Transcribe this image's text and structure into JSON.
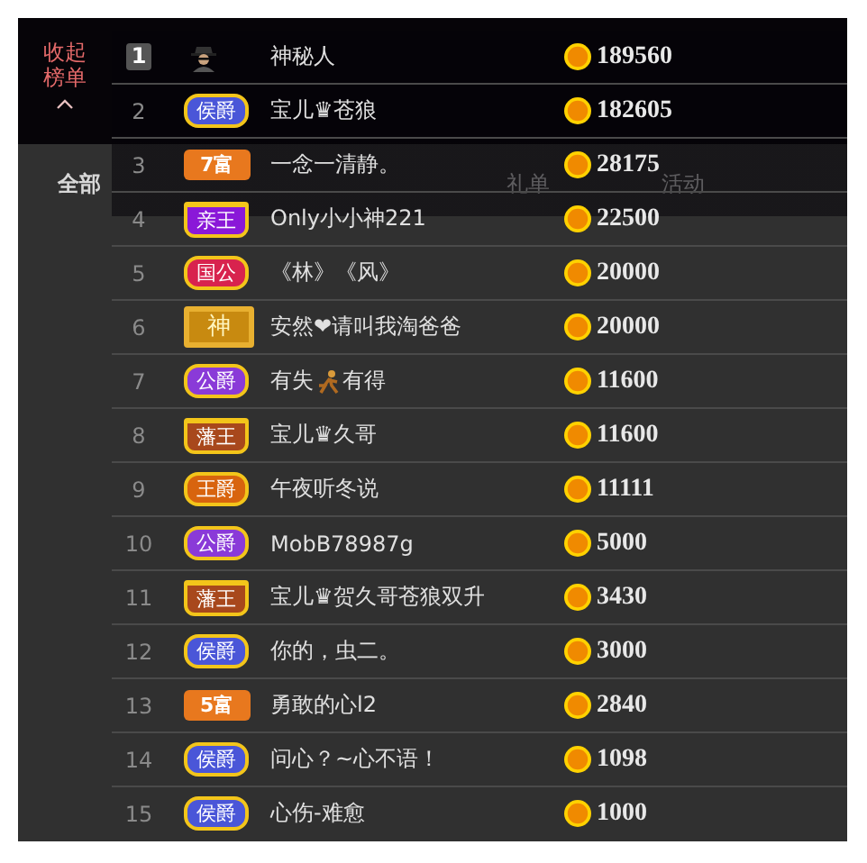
{
  "collapse": {
    "label": "收起榜单"
  },
  "tabs": [
    {
      "label": "全部",
      "selected": true
    },
    {
      "label": "礼单",
      "selected": false
    },
    {
      "label": "活动",
      "selected": false
    }
  ],
  "ranking": [
    {
      "rank": "1",
      "kind": "top",
      "name": [
        "神秘人"
      ],
      "coins": "189560"
    },
    {
      "rank": "2",
      "kind": "normal",
      "badge": {
        "kind": "noble",
        "text": "侯爵",
        "color": "#4a56d8"
      },
      "name": [
        "宝儿♛苍狼"
      ],
      "coins": "182605"
    },
    {
      "rank": "3",
      "kind": "normal",
      "badge": {
        "kind": "wealth",
        "text": "7富",
        "color": "#e8781e"
      },
      "name": [
        "一念一清静。"
      ],
      "coins": "28175"
    },
    {
      "rank": "4",
      "kind": "normal",
      "badge": {
        "kind": "crown",
        "text": "亲王",
        "color": "#8a18d8"
      },
      "name": [
        "Only小小神221"
      ],
      "coins": "22500"
    },
    {
      "rank": "5",
      "kind": "normal",
      "badge": {
        "kind": "noble",
        "text": "国公",
        "color": "#d8234e"
      },
      "name": [
        "《林》《风》"
      ],
      "coins": "20000"
    },
    {
      "rank": "6",
      "kind": "normal",
      "badge": {
        "kind": "god",
        "text": "神",
        "color": "#c88a10"
      },
      "name": [
        "安然❤请叫我淘爸爸"
      ],
      "coins": "20000"
    },
    {
      "rank": "7",
      "kind": "normal",
      "badge": {
        "kind": "noble",
        "text": "公爵",
        "color": "#8a3ad8"
      },
      "name": [
        "有失",
        "有得"
      ],
      "coins": "11600"
    },
    {
      "rank": "8",
      "kind": "normal",
      "badge": {
        "kind": "crown",
        "text": "藩王",
        "color": "#a8481c"
      },
      "name": [
        "宝儿♛久哥"
      ],
      "coins": "11600"
    },
    {
      "rank": "9",
      "kind": "normal",
      "badge": {
        "kind": "noble",
        "text": "王爵",
        "color": "#d8640e"
      },
      "name": [
        "午夜听冬说"
      ],
      "coins": "11111"
    },
    {
      "rank": "10",
      "kind": "normal",
      "badge": {
        "kind": "noble",
        "text": "公爵",
        "color": "#8a3ad8"
      },
      "name": [
        "MobB78987g"
      ],
      "coins": "5000"
    },
    {
      "rank": "11",
      "kind": "normal",
      "badge": {
        "kind": "crown",
        "text": "藩王",
        "color": "#a8481c"
      },
      "name": [
        "宝儿♛贺久哥苍狼双升"
      ],
      "coins": "3430"
    },
    {
      "rank": "12",
      "kind": "normal",
      "badge": {
        "kind": "noble",
        "text": "侯爵",
        "color": "#4a56d8"
      },
      "name": [
        "你的，虫二。"
      ],
      "coins": "3000"
    },
    {
      "rank": "13",
      "kind": "normal",
      "badge": {
        "kind": "wealth",
        "text": "5富",
        "color": "#e8781e"
      },
      "name": [
        "勇敢的心l2"
      ],
      "coins": "2840"
    },
    {
      "rank": "14",
      "kind": "normal",
      "badge": {
        "kind": "noble",
        "text": "侯爵",
        "color": "#4a56d8"
      },
      "name": [
        "问心？~心不语！"
      ],
      "coins": "1098"
    },
    {
      "rank": "15",
      "kind": "normal",
      "badge": {
        "kind": "noble",
        "text": "侯爵",
        "color": "#4a56d8"
      },
      "name": [
        "心伤-难愈"
      ],
      "coins": "1000"
    }
  ]
}
